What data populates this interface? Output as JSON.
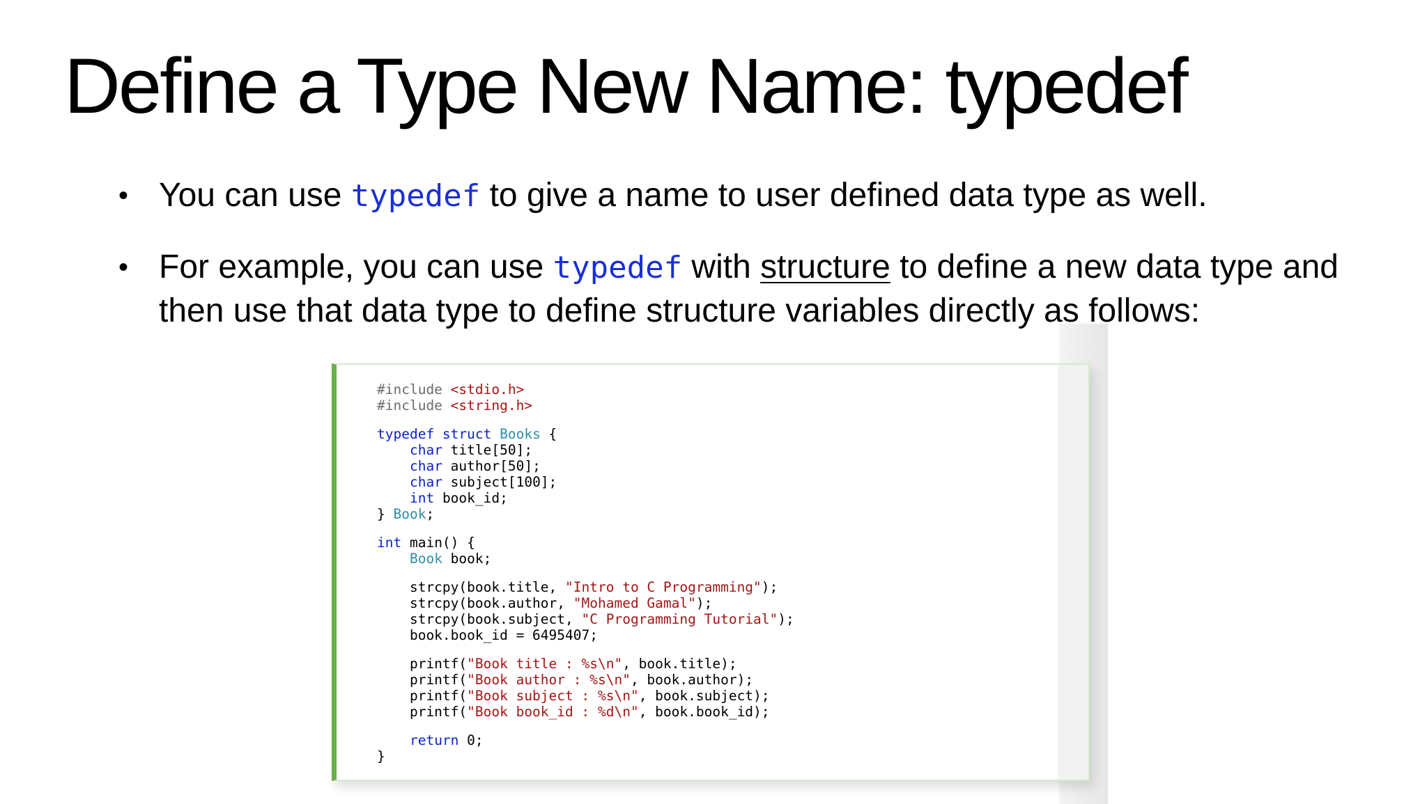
{
  "slide": {
    "title": "Define a Type New Name: typedef",
    "bullets": [
      {
        "segments": [
          {
            "text": "You can use ",
            "style": "plain"
          },
          {
            "text": "typedef",
            "style": "code"
          },
          {
            "text": " to give a name to user defined data type as well.",
            "style": "plain"
          }
        ]
      },
      {
        "segments": [
          {
            "text": "For example, you can use ",
            "style": "plain"
          },
          {
            "text": "typedef",
            "style": "code"
          },
          {
            "text": " with ",
            "style": "plain"
          },
          {
            "text": "structure",
            "style": "underline"
          },
          {
            "text": " to define a new data type and then use that data type to define structure variables directly as follows:",
            "style": "plain"
          }
        ]
      }
    ]
  },
  "code_block": {
    "lines": [
      {
        "gap_after": false,
        "tokens": [
          {
            "t": "#include ",
            "c": "pre"
          },
          {
            "t": "<stdio.h>",
            "c": "str"
          }
        ]
      },
      {
        "gap_after": true,
        "tokens": [
          {
            "t": "#include ",
            "c": "pre"
          },
          {
            "t": "<string.h>",
            "c": "str"
          }
        ]
      },
      {
        "gap_after": false,
        "tokens": [
          {
            "t": "typedef struct ",
            "c": "kw"
          },
          {
            "t": "Books",
            "c": "type"
          },
          {
            "t": " {",
            "c": "plain"
          }
        ]
      },
      {
        "gap_after": false,
        "tokens": [
          {
            "t": "    ",
            "c": "plain"
          },
          {
            "t": "char",
            "c": "kw"
          },
          {
            "t": " title[50];",
            "c": "plain"
          }
        ]
      },
      {
        "gap_after": false,
        "tokens": [
          {
            "t": "    ",
            "c": "plain"
          },
          {
            "t": "char",
            "c": "kw"
          },
          {
            "t": " author[50];",
            "c": "plain"
          }
        ]
      },
      {
        "gap_after": false,
        "tokens": [
          {
            "t": "    ",
            "c": "plain"
          },
          {
            "t": "char",
            "c": "kw"
          },
          {
            "t": " subject[100];",
            "c": "plain"
          }
        ]
      },
      {
        "gap_after": false,
        "tokens": [
          {
            "t": "    ",
            "c": "plain"
          },
          {
            "t": "int",
            "c": "kw"
          },
          {
            "t": " book_id;",
            "c": "plain"
          }
        ]
      },
      {
        "gap_after": true,
        "tokens": [
          {
            "t": "} ",
            "c": "plain"
          },
          {
            "t": "Book",
            "c": "type"
          },
          {
            "t": ";",
            "c": "plain"
          }
        ]
      },
      {
        "gap_after": false,
        "tokens": [
          {
            "t": "int",
            "c": "kw"
          },
          {
            "t": " main() {",
            "c": "plain"
          }
        ]
      },
      {
        "gap_after": true,
        "tokens": [
          {
            "t": "    ",
            "c": "plain"
          },
          {
            "t": "Book",
            "c": "type"
          },
          {
            "t": " book;",
            "c": "plain"
          }
        ]
      },
      {
        "gap_after": false,
        "tokens": [
          {
            "t": "    strcpy(book.title, ",
            "c": "plain"
          },
          {
            "t": "\"Intro to C Programming\"",
            "c": "str"
          },
          {
            "t": ");",
            "c": "plain"
          }
        ]
      },
      {
        "gap_after": false,
        "tokens": [
          {
            "t": "    strcpy(book.author, ",
            "c": "plain"
          },
          {
            "t": "\"Mohamed Gamal\"",
            "c": "str"
          },
          {
            "t": ");",
            "c": "plain"
          }
        ]
      },
      {
        "gap_after": false,
        "tokens": [
          {
            "t": "    strcpy(book.subject, ",
            "c": "plain"
          },
          {
            "t": "\"C Programming Tutorial\"",
            "c": "str"
          },
          {
            "t": ");",
            "c": "plain"
          }
        ]
      },
      {
        "gap_after": true,
        "tokens": [
          {
            "t": "    book.book_id = 6495407;",
            "c": "plain"
          }
        ]
      },
      {
        "gap_after": false,
        "tokens": [
          {
            "t": "    printf(",
            "c": "plain"
          },
          {
            "t": "\"Book title : %s\\n\"",
            "c": "str"
          },
          {
            "t": ", book.title);",
            "c": "plain"
          }
        ]
      },
      {
        "gap_after": false,
        "tokens": [
          {
            "t": "    printf(",
            "c": "plain"
          },
          {
            "t": "\"Book author : %s\\n\"",
            "c": "str"
          },
          {
            "t": ", book.author);",
            "c": "plain"
          }
        ]
      },
      {
        "gap_after": false,
        "tokens": [
          {
            "t": "    printf(",
            "c": "plain"
          },
          {
            "t": "\"Book subject : %s\\n\"",
            "c": "str"
          },
          {
            "t": ", book.subject);",
            "c": "plain"
          }
        ]
      },
      {
        "gap_after": true,
        "tokens": [
          {
            "t": "    printf(",
            "c": "plain"
          },
          {
            "t": "\"Book book_id : %d\\n\"",
            "c": "str"
          },
          {
            "t": ", book.book_id);",
            "c": "plain"
          }
        ]
      },
      {
        "gap_after": false,
        "tokens": [
          {
            "t": "    ",
            "c": "plain"
          },
          {
            "t": "return",
            "c": "kw"
          },
          {
            "t": " 0;",
            "c": "plain"
          }
        ]
      },
      {
        "gap_after": false,
        "tokens": [
          {
            "t": "}",
            "c": "plain"
          }
        ]
      }
    ]
  },
  "colors": {
    "accent_border": "#6ab04c",
    "inline_code": "#1a2fd6",
    "keyword": "#0b22c8",
    "type_name": "#2e8da8",
    "string": "#a31515",
    "preprocessor": "#6b6b6b"
  }
}
